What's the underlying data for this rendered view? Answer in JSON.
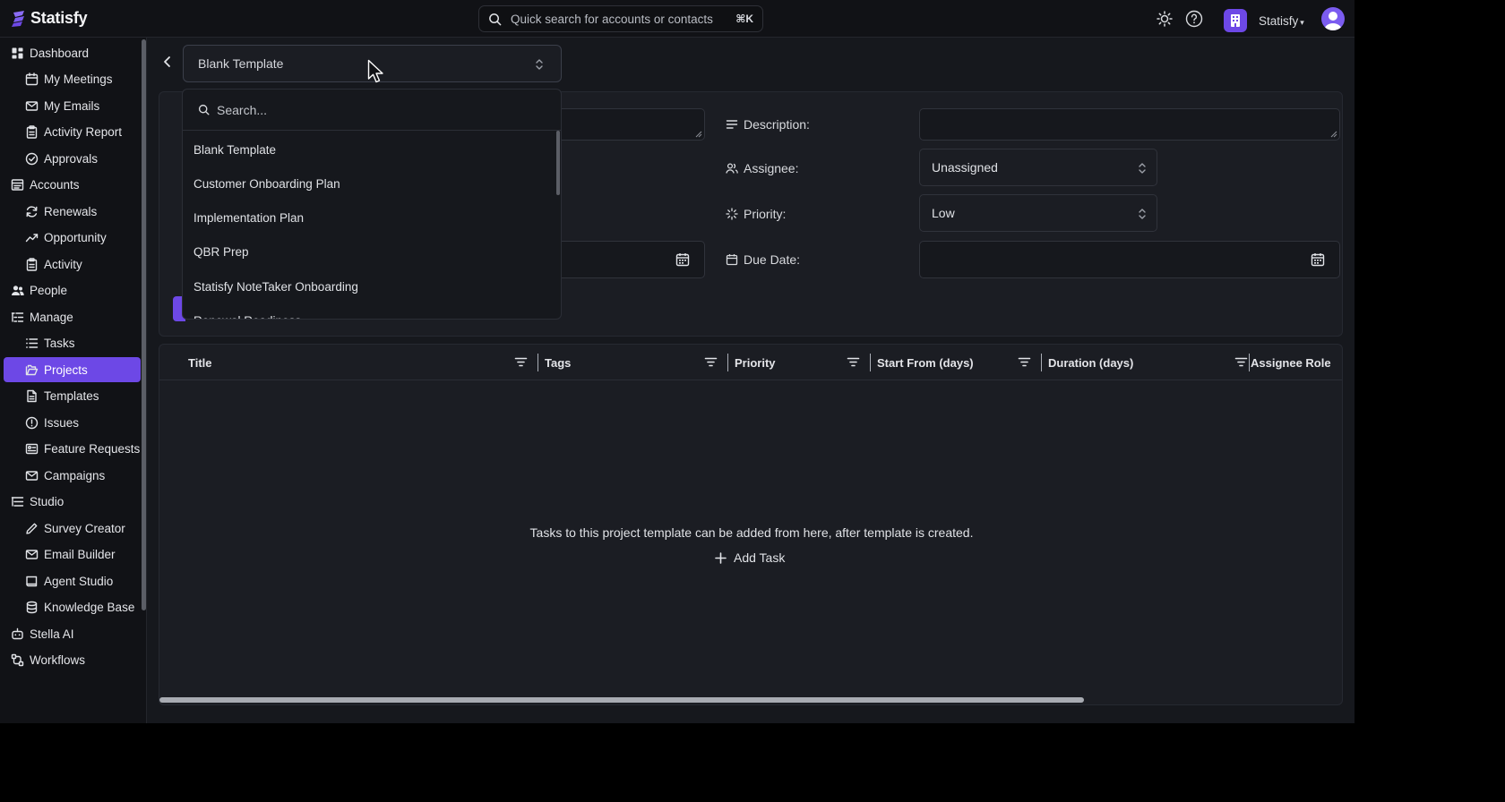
{
  "app": {
    "name": "Statisfy",
    "brand_color": "#6d48e6"
  },
  "topbar": {
    "search_placeholder": "Quick search for accounts or contacts",
    "shortcut": "⌘K",
    "workspace_name": "Statisfy",
    "icons": [
      "sun-icon",
      "help-icon"
    ]
  },
  "sidebar": {
    "items": [
      {
        "label": "Dashboard",
        "icon": "dashboard-icon",
        "level": "top"
      },
      {
        "label": "My Meetings",
        "icon": "calendar-icon",
        "level": "sub"
      },
      {
        "label": "My Emails",
        "icon": "mail-icon",
        "level": "sub"
      },
      {
        "label": "Activity Report",
        "icon": "clipboard-icon",
        "level": "sub"
      },
      {
        "label": "Approvals",
        "icon": "check-circle-icon",
        "level": "sub"
      },
      {
        "label": "Accounts",
        "icon": "accounts-icon",
        "level": "top"
      },
      {
        "label": "Renewals",
        "icon": "refresh-icon",
        "level": "sub"
      },
      {
        "label": "Opportunity",
        "icon": "trend-icon",
        "level": "sub"
      },
      {
        "label": "Activity",
        "icon": "clipboard-icon",
        "level": "sub"
      },
      {
        "label": "People",
        "icon": "people-icon",
        "level": "top"
      },
      {
        "label": "Manage",
        "icon": "manage-icon",
        "level": "top"
      },
      {
        "label": "Tasks",
        "icon": "list-icon",
        "level": "sub"
      },
      {
        "label": "Projects",
        "icon": "folder-icon",
        "level": "sub",
        "active": true
      },
      {
        "label": "Templates",
        "icon": "file-icon",
        "level": "sub"
      },
      {
        "label": "Issues",
        "icon": "alert-icon",
        "level": "sub"
      },
      {
        "label": "Feature Requests",
        "icon": "feature-icon",
        "level": "sub"
      },
      {
        "label": "Campaigns",
        "icon": "mail-icon",
        "level": "sub"
      },
      {
        "label": "Studio",
        "icon": "studio-icon",
        "level": "top"
      },
      {
        "label": "Survey Creator",
        "icon": "pen-icon",
        "level": "sub"
      },
      {
        "label": "Email Builder",
        "icon": "mail-icon",
        "level": "sub"
      },
      {
        "label": "Agent Studio",
        "icon": "book-icon",
        "level": "sub"
      },
      {
        "label": "Knowledge Base",
        "icon": "database-icon",
        "level": "sub"
      },
      {
        "label": "Stella AI",
        "icon": "bot-icon",
        "level": "top"
      },
      {
        "label": "Workflows",
        "icon": "workflow-icon",
        "level": "top"
      }
    ]
  },
  "template_select": {
    "value": "Blank Template"
  },
  "dropdown": {
    "search_placeholder": "Search...",
    "options": [
      "Blank Template",
      "Customer Onboarding Plan",
      "Implementation Plan",
      "QBR Prep",
      "Statisfy NoteTaker Onboarding",
      "Renewal Readiness"
    ]
  },
  "form": {
    "description_label": "Description:",
    "assignee_label": "Assignee:",
    "assignee_value": "Unassigned",
    "priority_label": "Priority:",
    "priority_value": "Low",
    "due_date_label": "Due Date:"
  },
  "table": {
    "columns": [
      "Title",
      "Tags",
      "Priority",
      "Start From (days)",
      "Duration (days)",
      "Assignee Role"
    ],
    "empty_message": "Tasks to this project template can be added from here, after template is created.",
    "add_task_label": "Add Task"
  }
}
